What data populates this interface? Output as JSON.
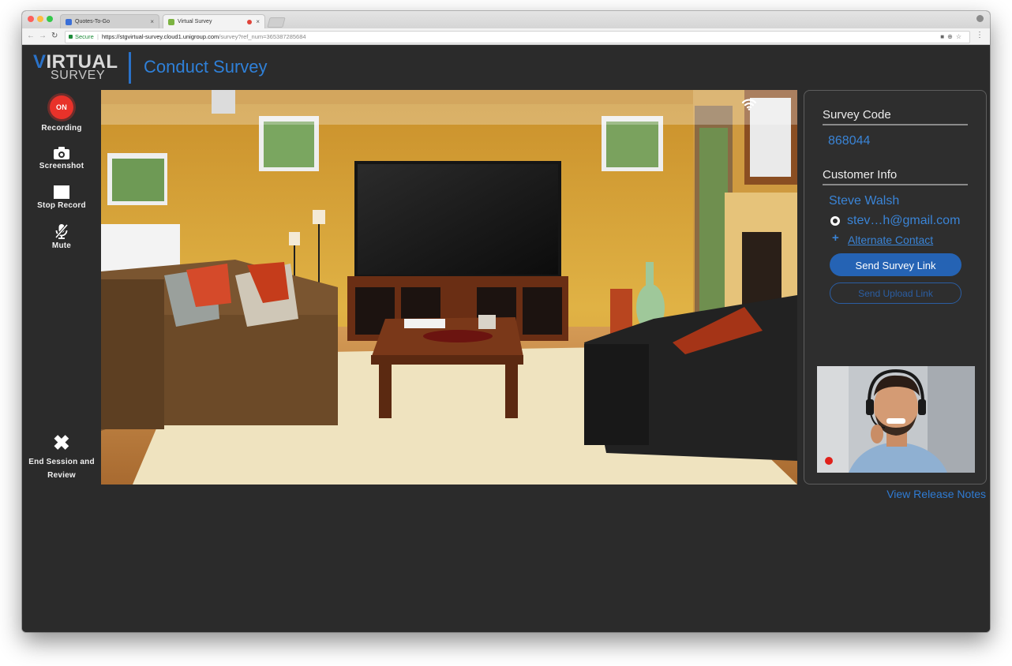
{
  "browser": {
    "tabs": [
      {
        "title": "Quotes-To-Go",
        "favicon_color": "#3a6fd8"
      },
      {
        "title": "Virtual Survey",
        "favicon_color": "#7cb342",
        "recording": true
      }
    ],
    "secure_label": "Secure",
    "url_main": "https://stgvirtual-survey.cloud1.unigroup.com",
    "url_path": "/survey?ref_num=365387285684"
  },
  "header": {
    "logo_line1_accent": "V",
    "logo_line1_rest": "IRTUAL",
    "logo_line2": "SURVEY",
    "title": "Conduct Survey"
  },
  "toolbar": {
    "recording_badge": "ON",
    "recording_label": "Recording",
    "screenshot_label": "Screenshot",
    "stop_label": "Stop Record",
    "mute_label": "Mute",
    "end_label": "End Session and Review"
  },
  "panel": {
    "survey_code_heading": "Survey Code",
    "survey_code": "868044",
    "customer_heading": "Customer Info",
    "customer_name": "Steve Walsh",
    "customer_email": "stev…h@gmail.com",
    "alternate_contact": "Alternate Contact",
    "send_survey_link": "Send Survey Link",
    "send_upload_link": "Send Upload Link"
  },
  "footer": {
    "release_notes": "View Release Notes"
  },
  "colors": {
    "accent": "#2f80d8",
    "record_red": "#e8322a",
    "background": "#2b2b2b"
  }
}
